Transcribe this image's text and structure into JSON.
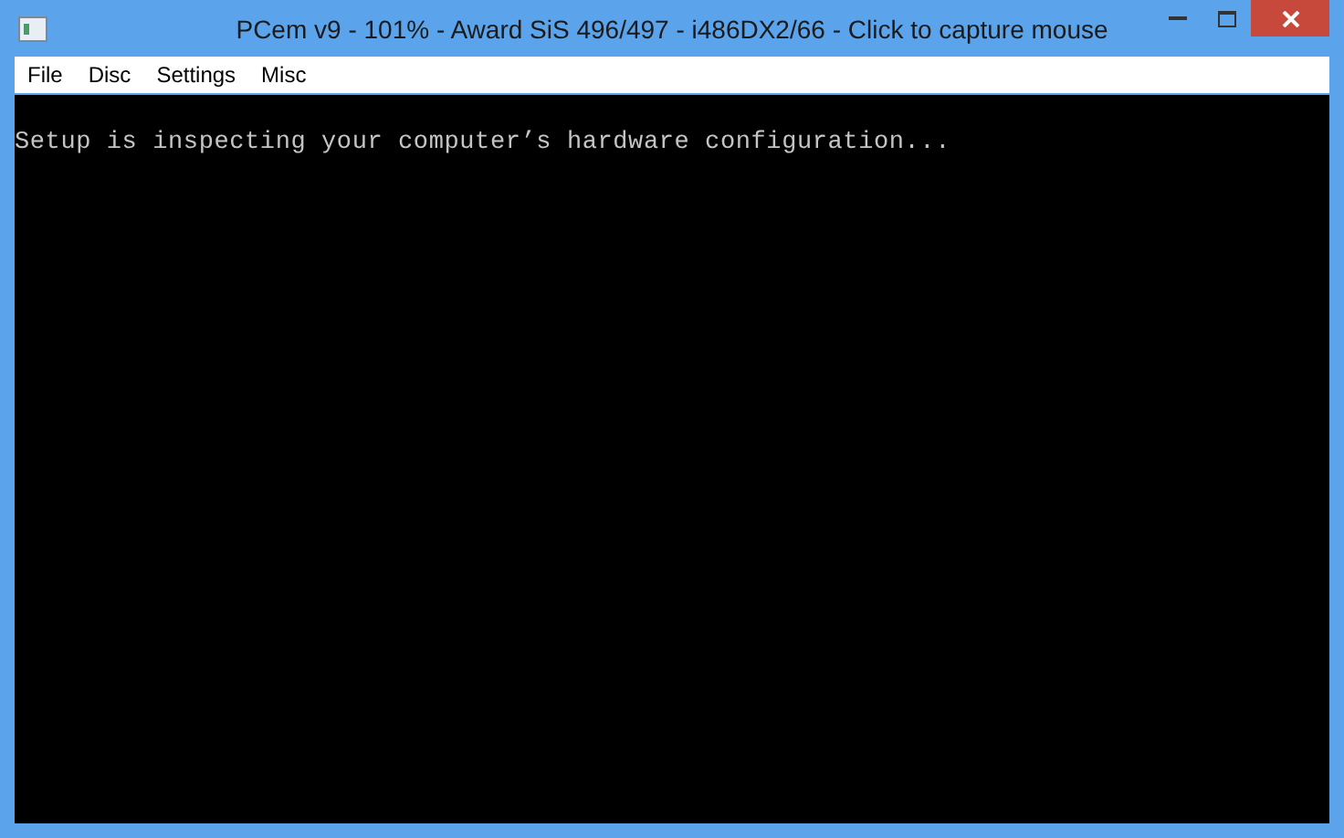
{
  "window": {
    "title": "PCem v9 - 101% - Award SiS 496/497 - i486DX2/66 - Click to capture mouse"
  },
  "menu": [
    "File",
    "Disc",
    "Settings",
    "Misc"
  ],
  "screen": {
    "lines": [
      "Setup is inspecting your computer’s hardware configuration..."
    ]
  }
}
